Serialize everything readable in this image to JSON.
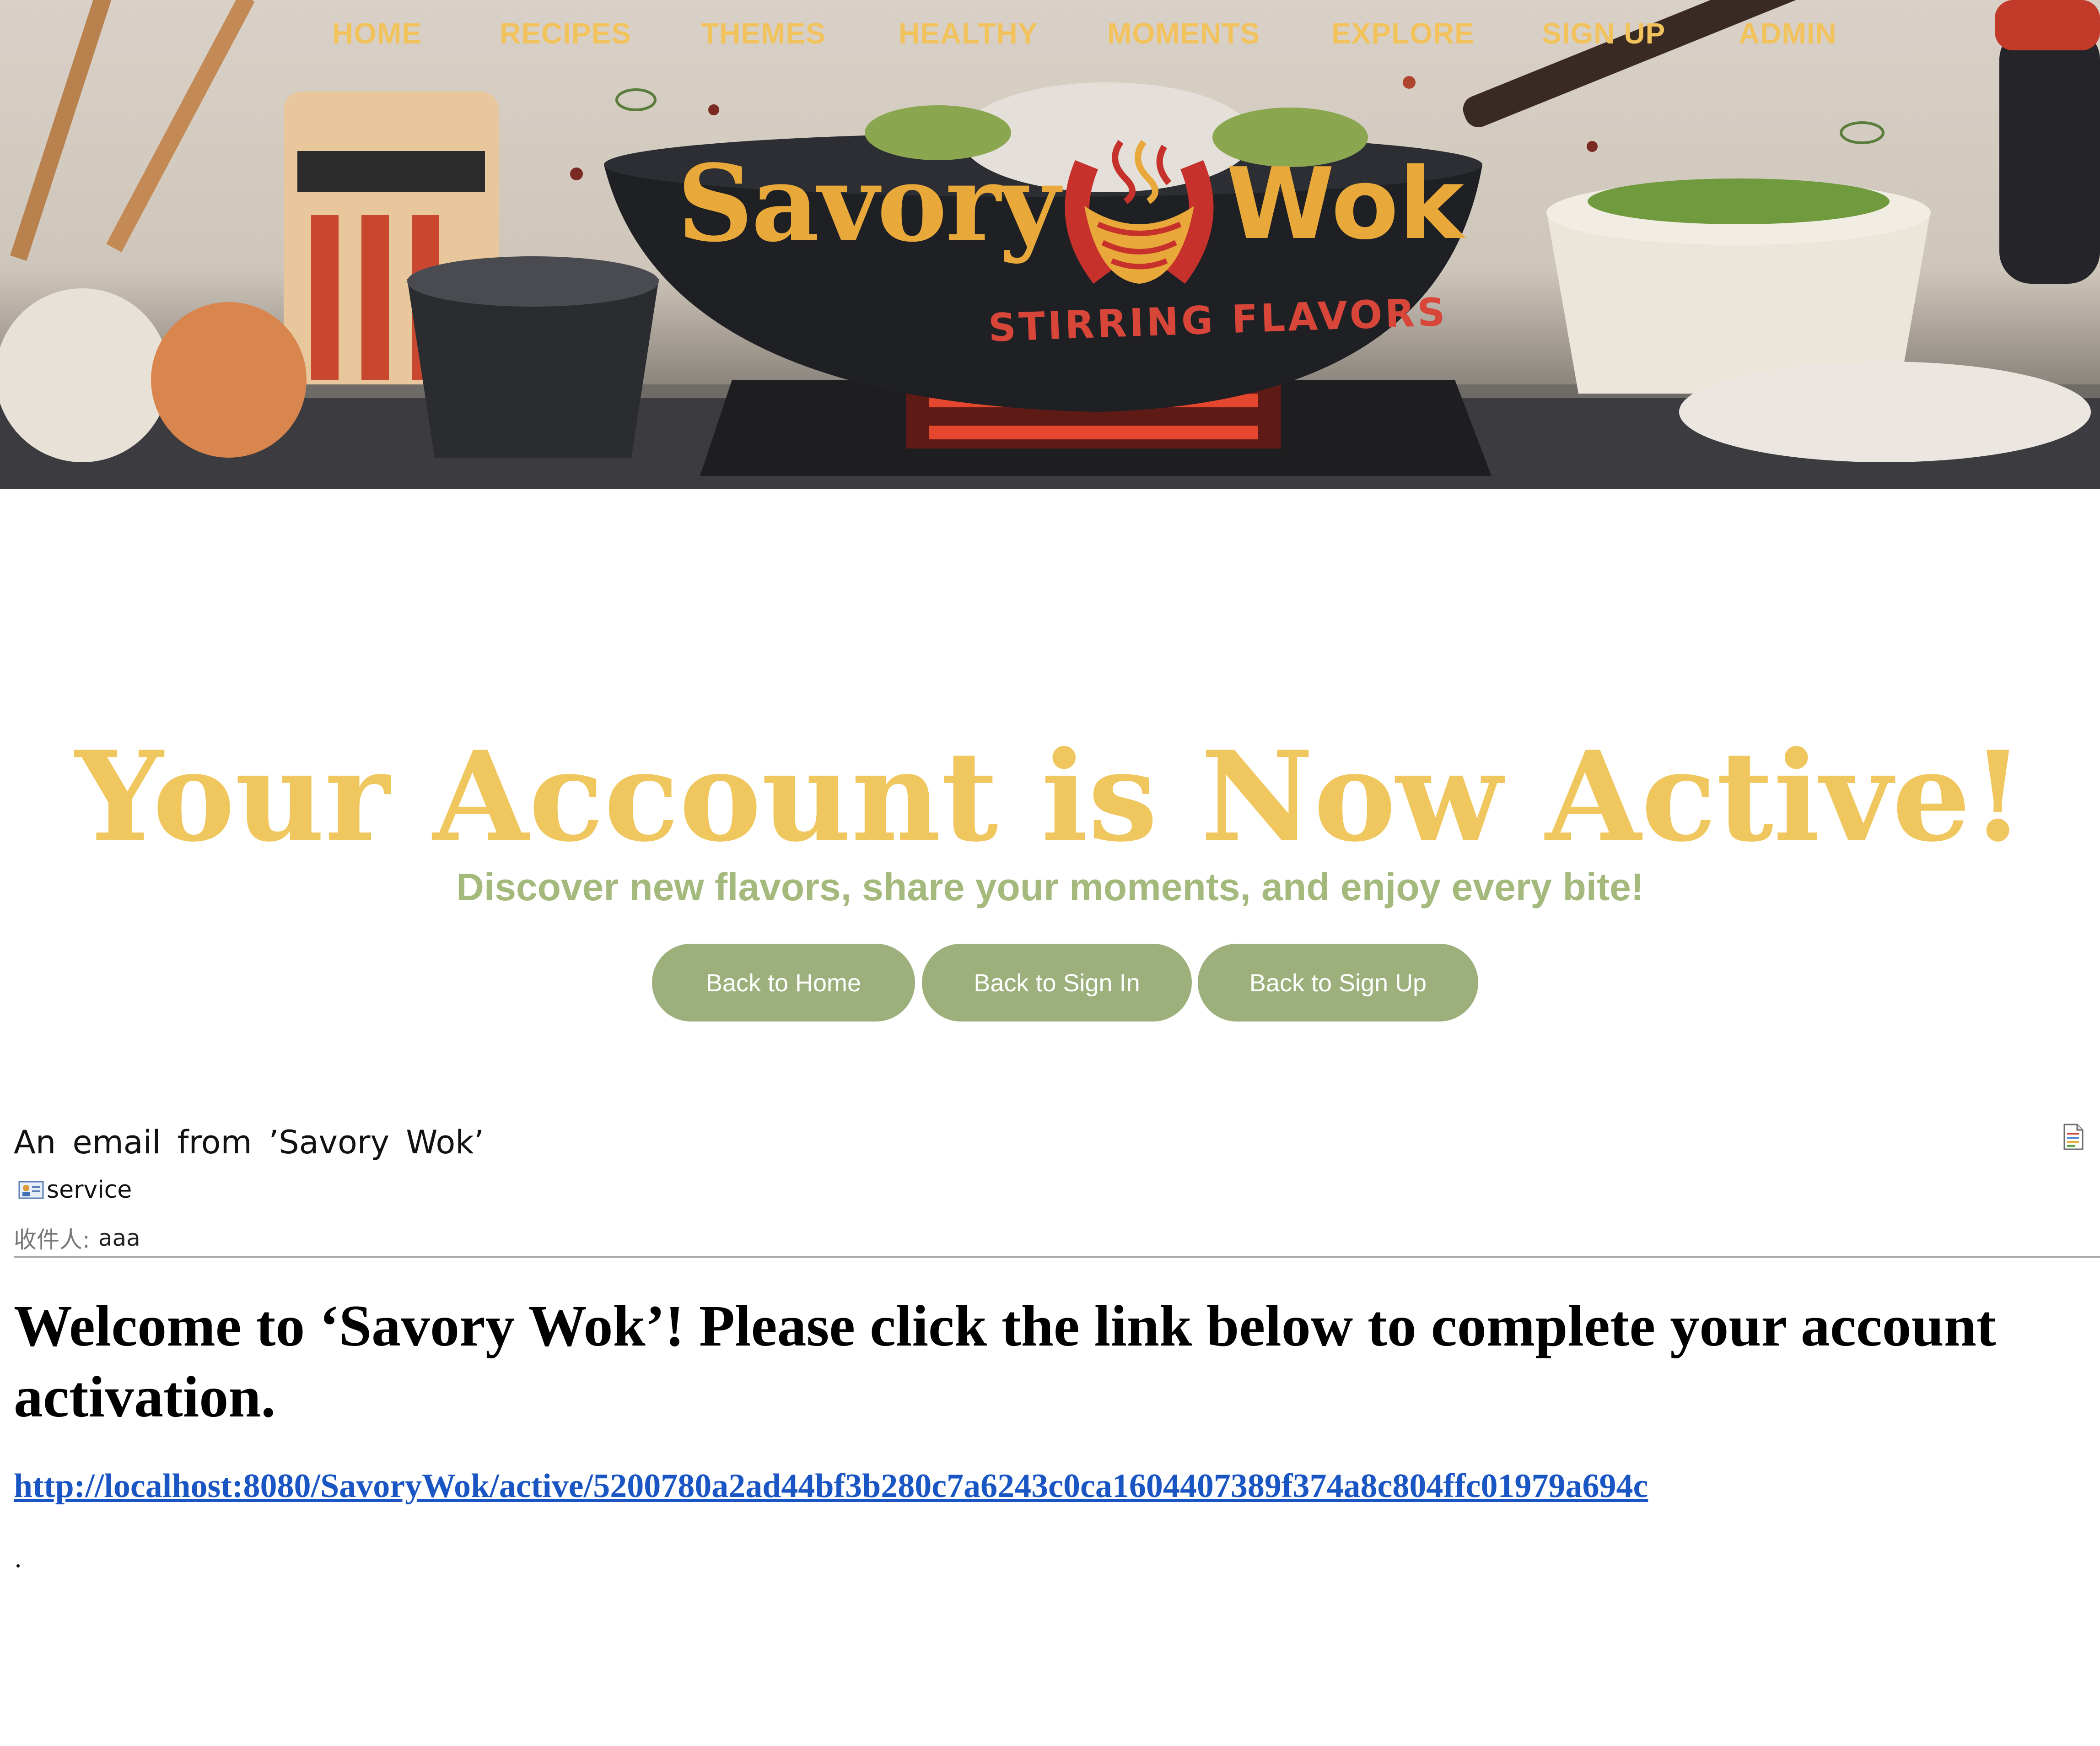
{
  "nav": {
    "items": [
      {
        "label": "HOME"
      },
      {
        "label": "RECIPES"
      },
      {
        "label": "THEMES"
      },
      {
        "label": "HEALTHY"
      },
      {
        "label": "MOMENTS"
      },
      {
        "label": "EXPLORE"
      },
      {
        "label": "SIGN UP"
      },
      {
        "label": "ADMIN"
      }
    ]
  },
  "logo": {
    "word_left": "Savory",
    "word_right": "Wok",
    "tagline": "STIRRING FLAVORS"
  },
  "main": {
    "title": "Your Account is Now Active!",
    "subtitle": "Discover new flavors, share your moments, and enjoy every bite!",
    "buttons": [
      {
        "label": "Back to Home"
      },
      {
        "label": "Back to Sign In"
      },
      {
        "label": "Back to Sign Up"
      }
    ]
  },
  "email": {
    "subject": "An email from ’Savory Wok’",
    "sender": "service",
    "recipient_label": "收件人:",
    "recipient": "aaa",
    "heading": "Welcome to ‘Savory Wok’! Please click the link below to complete your account activation.",
    "link": "http://localhost:8080/SavoryWok/active/5200780a2ad44bf3b280c7a6243c0ca1604407389f374a8c804ffc01979a694c",
    "tail": "."
  },
  "colors": {
    "nav_text": "#f2c25c",
    "title": "#efc75e",
    "subtitle": "#a4b97c",
    "button_bg": "#9db07c",
    "link": "#1a55c4",
    "logo_gold": "#e9a93a",
    "logo_red": "#d8463a"
  },
  "icons": {
    "sender": "contact-card-icon",
    "document": "document-icon"
  }
}
